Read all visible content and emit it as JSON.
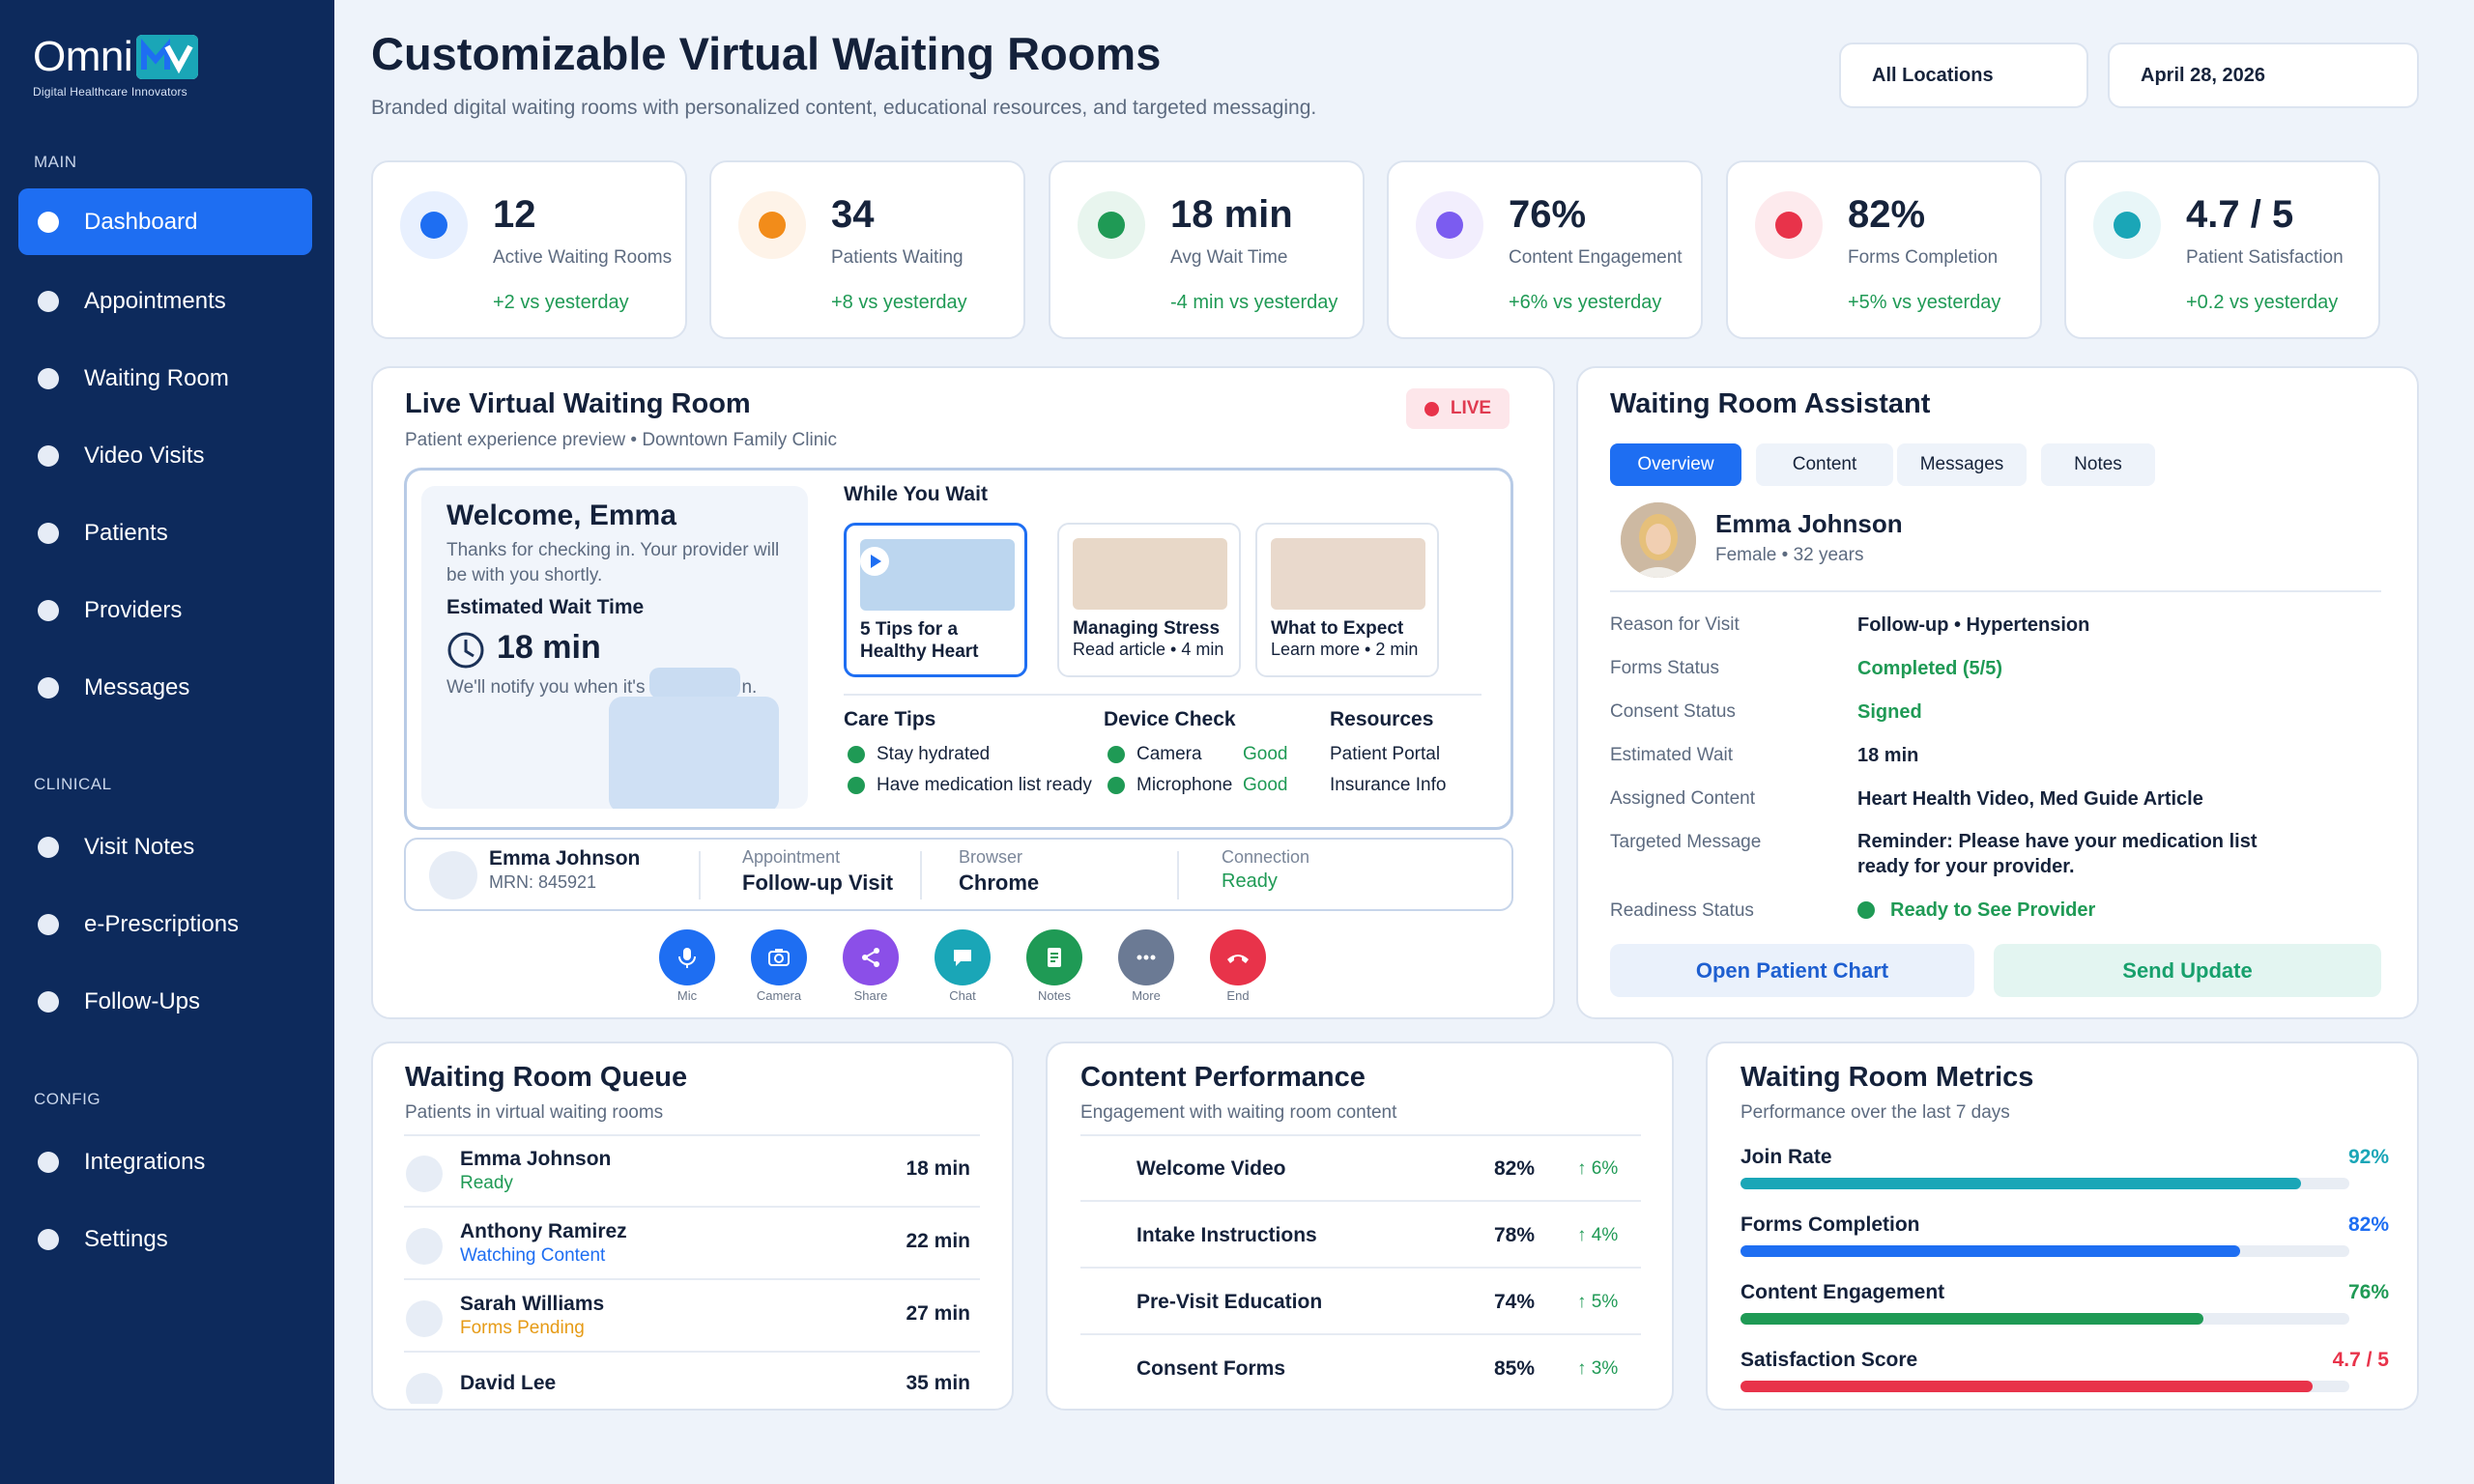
{
  "brand": {
    "name": "Omni",
    "tagline": "Digital Healthcare Innovators"
  },
  "sidebar": {
    "sections": [
      {
        "label": "MAIN"
      },
      {
        "label": "CLINICAL"
      },
      {
        "label": "CONFIG"
      }
    ],
    "items": [
      {
        "label": "Dashboard",
        "active": true
      },
      {
        "label": "Appointments"
      },
      {
        "label": "Waiting Room"
      },
      {
        "label": "Video Visits"
      },
      {
        "label": "Patients"
      },
      {
        "label": "Providers"
      },
      {
        "label": "Messages"
      },
      {
        "label": "Visit Notes"
      },
      {
        "label": "e-Prescriptions"
      },
      {
        "label": "Follow-Ups"
      },
      {
        "label": "Integrations"
      },
      {
        "label": "Settings"
      }
    ]
  },
  "header": {
    "title": "Customizable Virtual Waiting Rooms",
    "subtitle": "Branded digital waiting rooms with personalized content, educational resources, and targeted messaging.",
    "location_select": "All Locations",
    "date_select": "April 28, 2026"
  },
  "stats": [
    {
      "value": "12",
      "label": "Active Waiting Rooms",
      "delta": "+2 vs yesterday",
      "color": "#1e6ef2"
    },
    {
      "value": "34",
      "label": "Patients Waiting",
      "delta": "+8 vs yesterday",
      "color": "#f28c1a"
    },
    {
      "value": "18 min",
      "label": "Avg Wait Time",
      "delta": "-4 min vs yesterday",
      "color": "#1f9a55"
    },
    {
      "value": "76%",
      "label": "Content Engagement",
      "delta": "+6% vs yesterday",
      "color": "#7b5cf0"
    },
    {
      "value": "82%",
      "label": "Forms Completion",
      "delta": "+5% vs yesterday",
      "color": "#e8334a"
    },
    {
      "value": "4.7 / 5",
      "label": "Patient Satisfaction",
      "delta": "+0.2 vs yesterday",
      "color": "#1aa6b7"
    }
  ],
  "live_room": {
    "title": "Live Virtual Waiting Room",
    "subtitle": "Patient experience preview • Downtown Family Clinic",
    "badge": "LIVE",
    "welcome_title": "Welcome, Emma",
    "welcome_text": "Thanks for checking in. Your provider will be with you shortly.",
    "wait_label": "Estimated Wait Time",
    "wait_value": "18 min",
    "wait_note": "We'll notify you when it's",
    "wait_note_tail": "n.",
    "while_you_wait": "While You Wait",
    "content_cards": [
      {
        "title": "5 Tips for a",
        "title2": "Healthy Heart",
        "sub": "",
        "thumb": "#bcd6ef"
      },
      {
        "title": "Managing Stress",
        "title2": "",
        "sub": "Read article • 4 min",
        "thumb": "#e8d8c8"
      },
      {
        "title": "What to Expect",
        "title2": "",
        "sub": "Learn more • 2 min",
        "thumb": "#e9d9cc"
      }
    ],
    "care_tips_title": "Care Tips",
    "care_tips": [
      "Stay hydrated",
      "Have medication list ready"
    ],
    "device_check_title": "Device Check",
    "device_check": [
      {
        "label": "Camera",
        "status": "Good"
      },
      {
        "label": "Microphone",
        "status": "Good"
      }
    ],
    "resources_title": "Resources",
    "resources": [
      "Patient Portal",
      "Insurance Info"
    ],
    "patient_bar": {
      "name": "Emma Johnson",
      "mrn": "MRN: 845921",
      "appointment_label": "Appointment",
      "appointment_value": "Follow-up Visit",
      "browser_label": "Browser",
      "browser_value": "Chrome",
      "connection_label": "Connection",
      "connection_value": "Ready"
    },
    "controls": [
      {
        "label": "Mic",
        "color": "#1e6ef2",
        "icon": "mic-icon"
      },
      {
        "label": "Camera",
        "color": "#1e6ef2",
        "icon": "camera-icon"
      },
      {
        "label": "Share",
        "color": "#8b4fe8",
        "icon": "share-icon"
      },
      {
        "label": "Chat",
        "color": "#1aa6b7",
        "icon": "chat-icon"
      },
      {
        "label": "Notes",
        "color": "#1f9a55",
        "icon": "notes-icon"
      },
      {
        "label": "More",
        "color": "#6b7a94",
        "icon": "more-icon"
      },
      {
        "label": "End",
        "color": "#e8334a",
        "icon": "end-call-icon"
      }
    ]
  },
  "assistant": {
    "title": "Waiting Room Assistant",
    "tabs": [
      "Overview",
      "Content",
      "Messages",
      "Notes"
    ],
    "patient_name": "Emma Johnson",
    "patient_meta": "Female • 32 years",
    "fields": [
      {
        "key": "Reason for Visit",
        "value": "Follow-up • Hypertension",
        "green": false
      },
      {
        "key": "Forms Status",
        "value": "Completed (5/5)",
        "green": true
      },
      {
        "key": "Consent Status",
        "value": "Signed",
        "green": true
      },
      {
        "key": "Estimated Wait",
        "value": "18 min",
        "green": false
      },
      {
        "key": "Assigned Content",
        "value": "Heart Health Video, Med Guide Article",
        "green": false
      },
      {
        "key": "Targeted Message",
        "value": "Reminder: Please have your medication list ready for your provider.",
        "green": false
      },
      {
        "key": "Readiness Status",
        "value": "Ready to See Provider",
        "green": true
      }
    ],
    "open_chart": "Open Patient Chart",
    "send_update": "Send Update"
  },
  "queue": {
    "title": "Waiting Room Queue",
    "subtitle": "Patients in virtual waiting rooms",
    "rows": [
      {
        "name": "Emma Johnson",
        "status": "Ready",
        "status_color": "#1f9a55",
        "time": "18 min"
      },
      {
        "name": "Anthony Ramirez",
        "status": "Watching Content",
        "status_color": "#1e6ef2",
        "time": "22 min"
      },
      {
        "name": "Sarah Williams",
        "status": "Forms Pending",
        "status_color": "#e69b16",
        "time": "27 min"
      },
      {
        "name": "David Lee",
        "status": "",
        "status_color": "#5d6b80",
        "time": "35 min"
      }
    ]
  },
  "content_performance": {
    "title": "Content Performance",
    "subtitle": "Engagement with waiting room content",
    "rows": [
      {
        "name": "Welcome Video",
        "pct": "82%",
        "delta": "↑ 6%"
      },
      {
        "name": "Intake Instructions",
        "pct": "78%",
        "delta": "↑ 4%"
      },
      {
        "name": "Pre-Visit Education",
        "pct": "74%",
        "delta": "↑ 5%"
      },
      {
        "name": "Consent Forms",
        "pct": "85%",
        "delta": "↑ 3%"
      }
    ]
  },
  "metrics": {
    "title": "Waiting Room Metrics",
    "subtitle": "Performance over the last 7 days",
    "rows": [
      {
        "label": "Join Rate",
        "value": "92%",
        "fraction": 0.92,
        "color": "#1aa6b7"
      },
      {
        "label": "Forms Completion",
        "value": "82%",
        "fraction": 0.82,
        "color": "#1e6ef2"
      },
      {
        "label": "Content Engagement",
        "value": "76%",
        "fraction": 0.76,
        "color": "#1f9a55"
      },
      {
        "label": "Satisfaction Score",
        "value": "4.7 / 5",
        "fraction": 0.94,
        "color": "#e8334a"
      }
    ]
  }
}
